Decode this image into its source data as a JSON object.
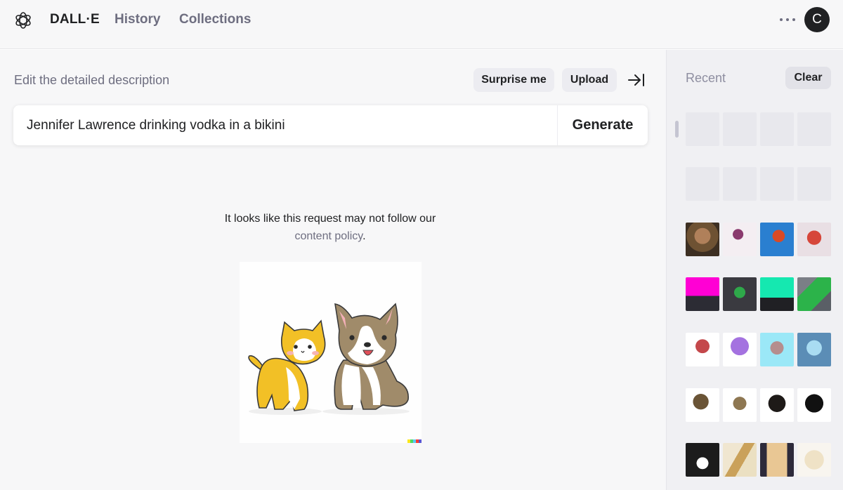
{
  "nav": {
    "logo": "openai-logo-icon",
    "brand": "DALL·E",
    "history": "History",
    "collections": "Collections",
    "avatar_initial": "C"
  },
  "editor": {
    "label": "Edit the detailed description",
    "surprise_label": "Surprise me",
    "upload_label": "Upload",
    "prompt_value": "Jennifer Lawrence drinking vodka in a bikini",
    "generate_label": "Generate"
  },
  "policy": {
    "line1": "It looks like this request may not follow our",
    "link_text": "content policy",
    "end": "."
  },
  "recent": {
    "title": "Recent",
    "clear_label": "Clear",
    "rows": [
      {
        "theme": "placeholder"
      },
      {
        "theme": "placeholder"
      },
      {
        "theme": "octopus-photo"
      },
      {
        "theme": "times-square-billboard"
      },
      {
        "theme": "pixel-octopus"
      },
      {
        "theme": "hairy-creature-motorcycle"
      },
      {
        "theme": "macro-teeth"
      }
    ]
  },
  "colors": {
    "background": "#f7f7f8",
    "text": "#202123",
    "muted": "#6e6e80",
    "pill": "#ececf1"
  }
}
